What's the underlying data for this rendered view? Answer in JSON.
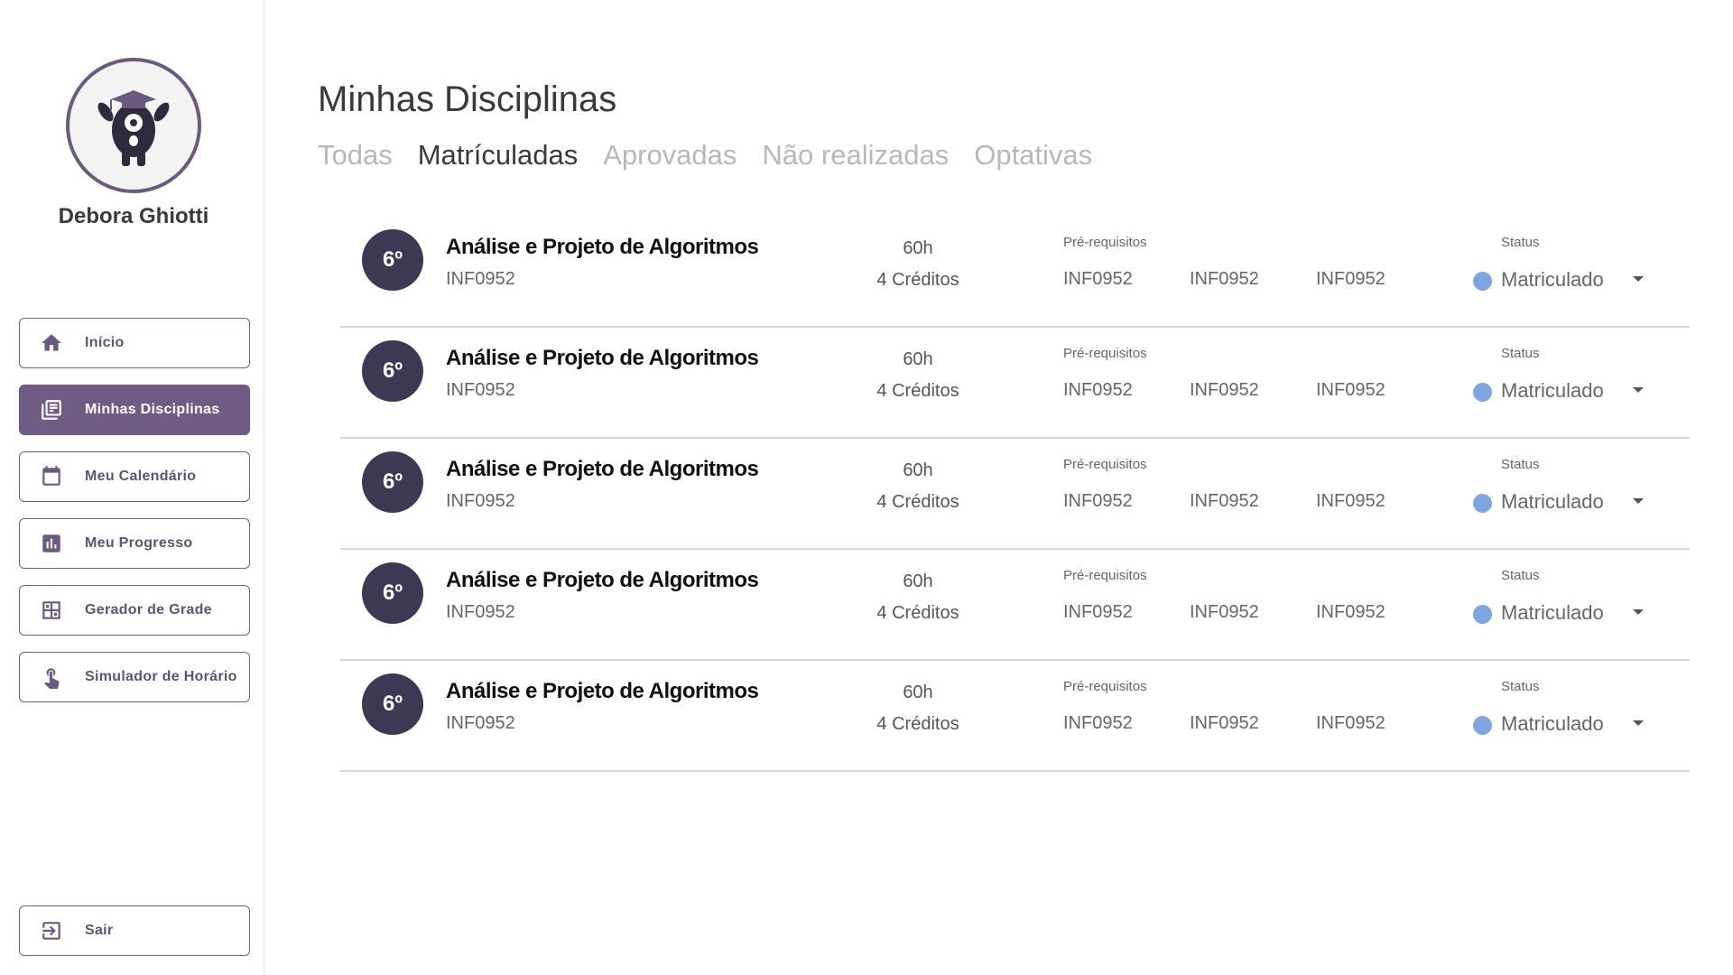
{
  "sidebar": {
    "user_name": "Debora Ghiotti",
    "nav": [
      {
        "label": "Início",
        "icon": "home-icon"
      },
      {
        "label": "Minhas Disciplinas",
        "icon": "library-books-icon"
      },
      {
        "label": "Meu Calendário",
        "icon": "calendar-icon"
      },
      {
        "label": "Meu Progresso",
        "icon": "bar-chart-icon"
      },
      {
        "label": "Gerador de Grade",
        "icon": "grid-icon"
      },
      {
        "label": "Simulador de Horário",
        "icon": "touch-icon"
      }
    ],
    "logout_label": "Sair",
    "active_item": "Minhas Disciplinas"
  },
  "main": {
    "title": "Minhas Disciplinas",
    "tabs": [
      "Todas",
      "Matrículadas",
      "Aprovadas",
      "Não realizadas",
      "Optativas"
    ],
    "active_tab": "Matrículadas",
    "prereq_label": "Pré-requisitos",
    "status_label": "Status",
    "courses": [
      {
        "semester": "6º",
        "name": "Análise e Projeto de Algoritmos",
        "code": "INF0952",
        "hours": "60h",
        "credits": "4 Créditos",
        "prerequisites": [
          "INF0952",
          "INF0952",
          "INF0952"
        ],
        "status": "Matriculado"
      },
      {
        "semester": "6º",
        "name": "Análise e Projeto de Algoritmos",
        "code": "INF0952",
        "hours": "60h",
        "credits": "4 Créditos",
        "prerequisites": [
          "INF0952",
          "INF0952",
          "INF0952"
        ],
        "status": "Matriculado"
      },
      {
        "semester": "6º",
        "name": "Análise e Projeto de Algoritmos",
        "code": "INF0952",
        "hours": "60h",
        "credits": "4 Créditos",
        "prerequisites": [
          "INF0952",
          "INF0952",
          "INF0952"
        ],
        "status": "Matriculado"
      },
      {
        "semester": "6º",
        "name": "Análise e Projeto de Algoritmos",
        "code": "INF0952",
        "hours": "60h",
        "credits": "4 Créditos",
        "prerequisites": [
          "INF0952",
          "INF0952",
          "INF0952"
        ],
        "status": "Matriculado"
      },
      {
        "semester": "6º",
        "name": "Análise e Projeto de Algoritmos",
        "code": "INF0952",
        "hours": "60h",
        "credits": "4 Créditos",
        "prerequisites": [
          "INF0952",
          "INF0952",
          "INF0952"
        ],
        "status": "Matriculado"
      }
    ]
  },
  "colors": {
    "accent": "#6f5c85",
    "badge": "#3b3953",
    "status_matriculado": "#7fa6e0"
  }
}
